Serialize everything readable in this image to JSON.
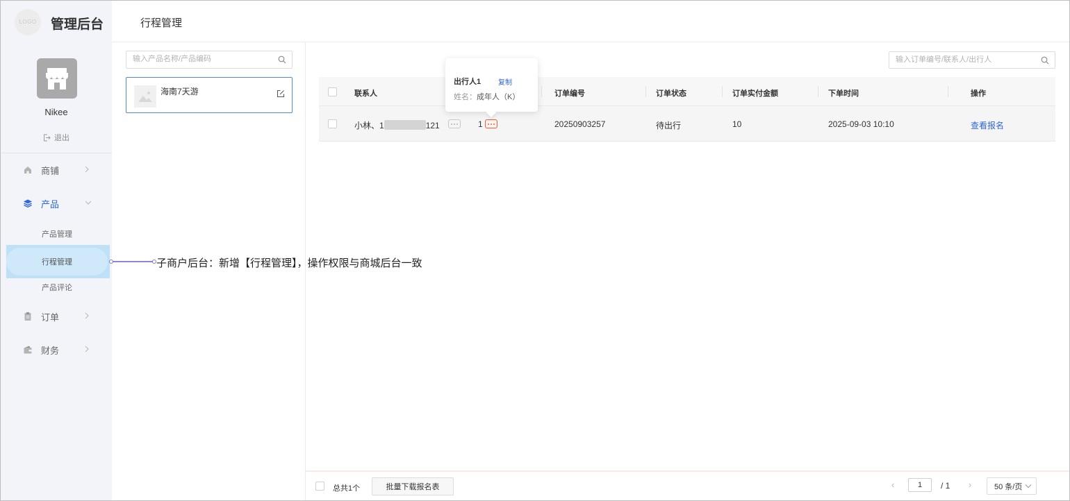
{
  "brand": {
    "logo_text": "LOGO",
    "title": "管理后台"
  },
  "page": {
    "title": "行程管理"
  },
  "user": {
    "name": "Nikee",
    "logout_label": "退出"
  },
  "sidebar": {
    "items": [
      {
        "label": "商铺",
        "icon": "home-icon"
      },
      {
        "label": "产品",
        "icon": "layers-icon",
        "active": true
      },
      {
        "label": "订单",
        "icon": "clipboard-icon"
      },
      {
        "label": "财务",
        "icon": "wallet-icon"
      }
    ],
    "product_sub": [
      "产品管理",
      "行程管理",
      "产品评论"
    ],
    "selected_sub": "行程管理"
  },
  "annotation": {
    "text": "子商户后台：新增【行程管理】，操作权限与商城后台一致"
  },
  "products": {
    "search_placeholder": "输入产品名称/产品编码",
    "items": [
      {
        "name": "海南7天游"
      }
    ]
  },
  "orders": {
    "search_placeholder": "输入订单编号/联系人/出行人",
    "columns": {
      "contact": "联系人",
      "order_no": "订单编号",
      "status": "订单状态",
      "amount": "订单实付金额",
      "time": "下单时间",
      "action": "操作"
    },
    "rows": [
      {
        "contact_prefix": "小林、1",
        "contact_suffix": "121",
        "traveler_count": "1",
        "order_no": "20250903257",
        "status": "待出行",
        "amount": "10",
        "time": "2025-09-03 10:10",
        "action": "查看报名"
      }
    ]
  },
  "popover": {
    "title": "出行人1",
    "copy_label": "复制",
    "name_key": "姓名：",
    "name_value": "成年人（K）"
  },
  "footer": {
    "total": "总共1个",
    "batch_button": "批量下载报名表",
    "page_current": "1",
    "page_total": "/ 1",
    "page_size": "50 条/页"
  },
  "colors": {
    "primary": "#2f66d9",
    "highlight": "#ff5a24",
    "sidebar_bg": "#f3f4f9",
    "selected_bg": "#bfe1f7",
    "annotation_line": "#8c85d9"
  }
}
